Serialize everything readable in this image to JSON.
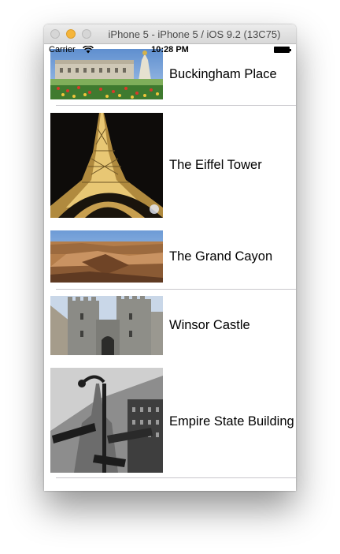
{
  "window": {
    "title": "iPhone 5 - iPhone 5 / iOS 9.2 (13C75)"
  },
  "status_bar": {
    "carrier": "Carrier",
    "time": "10:28 PM"
  },
  "rows": [
    {
      "label": "Buckingham Place",
      "image": "buckingham-palace-photo"
    },
    {
      "label": "The Eiffel Tower",
      "image": "eiffel-tower-photo"
    },
    {
      "label": "The Grand Cayon",
      "image": "grand-canyon-photo"
    },
    {
      "label": "Winsor Castle",
      "image": "windsor-castle-photo"
    },
    {
      "label": "Empire State Building",
      "image": "empire-state-building-photo"
    }
  ]
}
